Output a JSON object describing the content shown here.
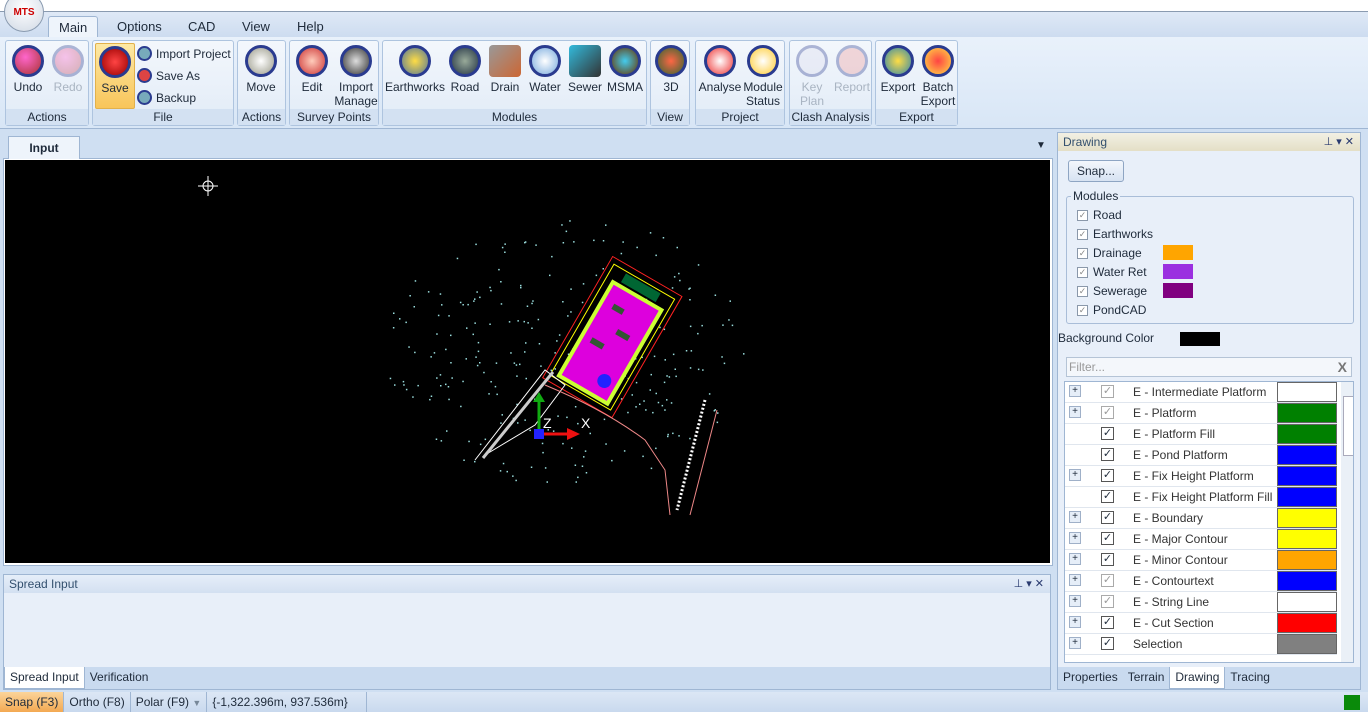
{
  "app": {
    "logo_text": "MTS"
  },
  "ribbon_tabs": [
    "Main",
    "Options",
    "CAD",
    "View",
    "Help"
  ],
  "groups": {
    "actions1": {
      "label": "Actions",
      "undo": "Undo",
      "redo": "Redo"
    },
    "file": {
      "label": "File",
      "save": "Save",
      "import_project": "Import Project",
      "save_as": "Save As",
      "backup": "Backup"
    },
    "actions2": {
      "label": "Actions",
      "move": "Move"
    },
    "survey": {
      "label": "Survey Points",
      "edit": "Edit",
      "import_manage": "Import Manage"
    },
    "modules": {
      "label": "Modules",
      "items": [
        "Earthworks",
        "Road",
        "Drain",
        "Water",
        "Sewer",
        "MSMA"
      ]
    },
    "view": {
      "label": "View",
      "d3": "3D"
    },
    "project": {
      "label": "Project",
      "analyse": "Analyse",
      "module_status": "Module Status"
    },
    "clash": {
      "label": "Clash Analysis",
      "key_plan": "Key Plan",
      "report": "Report"
    },
    "export": {
      "label": "Export",
      "export": "Export",
      "batch_export": "Batch Export"
    }
  },
  "document": {
    "tab": "Input",
    "axis_z": "Z",
    "axis_x": "X"
  },
  "spread": {
    "title": "Spread Input",
    "tabs": [
      "Spread Input",
      "Verification"
    ]
  },
  "drawing_panel": {
    "title": "Drawing",
    "snap_button": "Snap...",
    "modules_legend": "Modules",
    "modules": [
      {
        "label": "Road",
        "checked": true
      },
      {
        "label": "Earthworks",
        "checked": true
      },
      {
        "label": "Drainage",
        "checked": true,
        "color": "#FFA500"
      },
      {
        "label": "Water Ret",
        "checked": true,
        "color": "#9B30E0"
      },
      {
        "label": "Sewerage",
        "checked": true,
        "color": "#800080"
      },
      {
        "label": "PondCAD",
        "checked": true
      }
    ],
    "background_label": "Background Color",
    "background_color": "#000000",
    "filter_placeholder": "Filter...",
    "filter_clear": "X",
    "layers": [
      {
        "name": "E - Intermediate Platform",
        "color": "#FFFFFF",
        "expandable": true,
        "check": "grey"
      },
      {
        "name": "E - Platform",
        "color": "#008000",
        "expandable": true,
        "check": "grey"
      },
      {
        "name": "E - Platform Fill",
        "color": "#008000",
        "expandable": false,
        "check": "on"
      },
      {
        "name": "E - Pond Platform",
        "color": "#0000FF",
        "expandable": false,
        "check": "on"
      },
      {
        "name": "E - Fix Height Platform",
        "color": "#0000FF",
        "expandable": true,
        "check": "on"
      },
      {
        "name": "E - Fix Height Platform Fill",
        "color": "#0000FF",
        "expandable": false,
        "check": "on"
      },
      {
        "name": "E - Boundary",
        "color": "#FFFF00",
        "expandable": true,
        "check": "on"
      },
      {
        "name": "E - Major Contour",
        "color": "#FFFF00",
        "expandable": true,
        "check": "on"
      },
      {
        "name": "E - Minor Contour",
        "color": "#FFA500",
        "expandable": true,
        "check": "on"
      },
      {
        "name": "E - Contourtext",
        "color": "#0000FF",
        "expandable": true,
        "check": "grey"
      },
      {
        "name": "E - String Line",
        "color": "#FFFFFF",
        "expandable": true,
        "check": "grey"
      },
      {
        "name": "E - Cut Section",
        "color": "#FF0000",
        "expandable": true,
        "check": "on"
      },
      {
        "name": "Selection",
        "color": "#808080",
        "expandable": true,
        "check": "on"
      }
    ],
    "tabs": [
      "Properties",
      "Terrain",
      "Drawing",
      "Tracing"
    ],
    "active_tab": "Drawing"
  },
  "status": {
    "snap": "Snap (F3)",
    "ortho": "Ortho (F8)",
    "polar": "Polar (F9)",
    "coords": "{-1,322.396m, 937.536m}"
  }
}
